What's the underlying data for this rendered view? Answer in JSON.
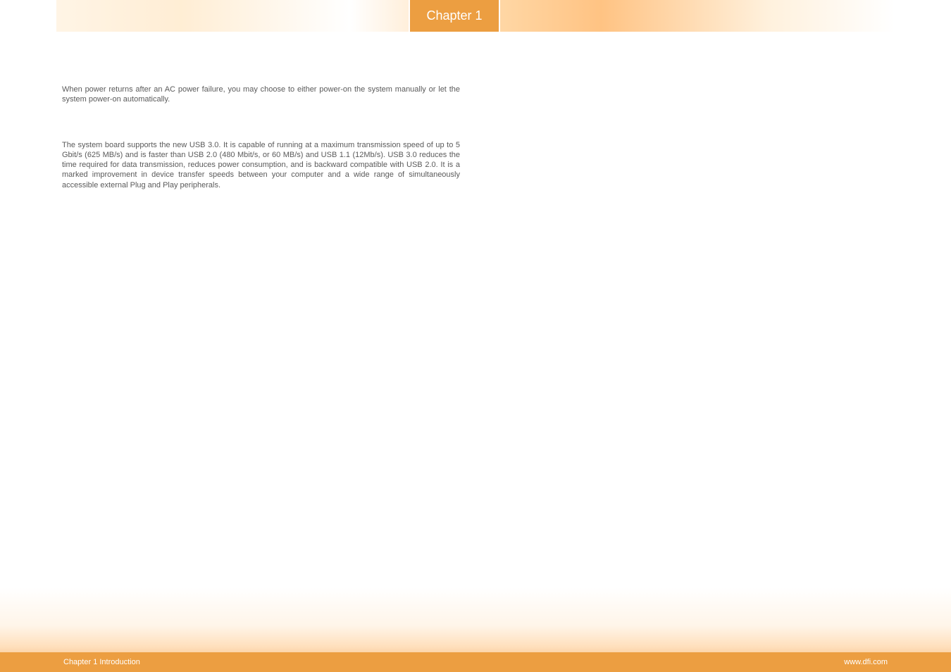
{
  "header": {
    "chapter_label": "Chapter 1"
  },
  "content": {
    "paragraph1": "When power returns after an AC power failure, you may choose to either power-on the system manually or let the system power-on automatically.",
    "paragraph2": "The system board supports the new USB 3.0. It is capable of running at a maximum transmission speed of up to 5 Gbit/s (625 MB/s) and is faster than USB 2.0 (480 Mbit/s, or 60 MB/s) and USB 1.1 (12Mb/s). USB 3.0 reduces the time required for data transmission, reduces power consumption, and is backward compatible with USB 2.0. It is  a marked  improvement in  device  transfer  speeds  between  your  computer  and  a wide range of simultaneously accessible external Plug and Play peripherals."
  },
  "footer": {
    "left_text": "Chapter 1 Introduction",
    "right_text": "www.dfi.com"
  }
}
